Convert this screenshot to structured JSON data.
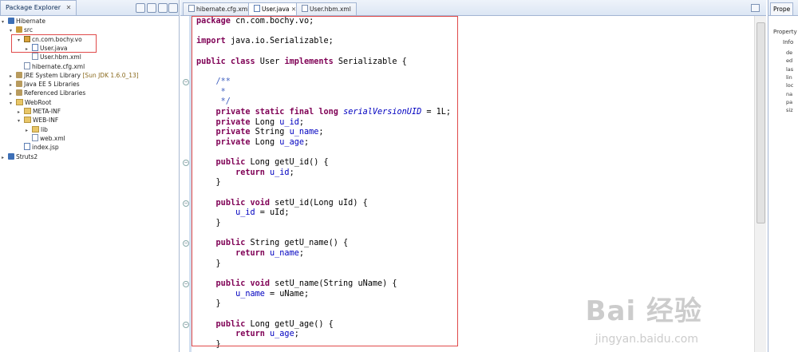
{
  "package_explorer": {
    "title": "Package Explorer",
    "tree": [
      {
        "indent": 0,
        "twisty": "▾",
        "icon": "project",
        "label": "Hibernate"
      },
      {
        "indent": 1,
        "twisty": "▾",
        "icon": "src",
        "label": "src"
      },
      {
        "indent": 2,
        "twisty": "▾",
        "icon": "package",
        "label": "cn.com.bochy.vo"
      },
      {
        "indent": 3,
        "twisty": "▸",
        "icon": "java",
        "label": "User.java"
      },
      {
        "indent": 3,
        "twisty": "",
        "icon": "xml",
        "label": "User.hbm.xml"
      },
      {
        "indent": 2,
        "twisty": "",
        "icon": "xml",
        "label": "hibernate.cfg.xml"
      },
      {
        "indent": 1,
        "twisty": "▸",
        "icon": "lib",
        "label": "JRE System Library",
        "suffix": "[Sun JDK 1.6.0_13]"
      },
      {
        "indent": 1,
        "twisty": "▸",
        "icon": "lib",
        "label": "Java EE 5 Libraries"
      },
      {
        "indent": 1,
        "twisty": "▸",
        "icon": "lib",
        "label": "Referenced Libraries"
      },
      {
        "indent": 1,
        "twisty": "▾",
        "icon": "folder",
        "label": "WebRoot"
      },
      {
        "indent": 2,
        "twisty": "▸",
        "icon": "folder",
        "label": "META-INF"
      },
      {
        "indent": 2,
        "twisty": "▾",
        "icon": "folder",
        "label": "WEB-INF"
      },
      {
        "indent": 3,
        "twisty": "▸",
        "icon": "folder",
        "label": "lib"
      },
      {
        "indent": 3,
        "twisty": "",
        "icon": "xml",
        "label": "web.xml"
      },
      {
        "indent": 2,
        "twisty": "",
        "icon": "java",
        "label": "index.jsp"
      },
      {
        "indent": 0,
        "twisty": "▸",
        "icon": "project",
        "label": "Struts2"
      }
    ]
  },
  "editor": {
    "tabs": [
      {
        "label": "hibernate.cfg.xml",
        "active": false
      },
      {
        "label": "User.java",
        "active": true
      },
      {
        "label": "User.hbm.xml",
        "active": false
      }
    ],
    "lines": [
      [
        {
          "t": "package",
          "c": "kw"
        },
        {
          "t": " cn.com.bochy.vo;"
        }
      ],
      [],
      [
        {
          "t": "import",
          "c": "kw"
        },
        {
          "t": " java.io.Serializable;"
        }
      ],
      [],
      [
        {
          "t": "public",
          "c": "kw"
        },
        {
          "t": " "
        },
        {
          "t": "class",
          "c": "kw"
        },
        {
          "t": " User "
        },
        {
          "t": "implements",
          "c": "kw"
        },
        {
          "t": " Serializable {"
        }
      ],
      [],
      [
        {
          "t": "    /**",
          "c": "cm"
        }
      ],
      [
        {
          "t": "     *",
          "c": "cm"
        }
      ],
      [
        {
          "t": "     */",
          "c": "cm"
        }
      ],
      [
        {
          "t": "    "
        },
        {
          "t": "private",
          "c": "kw"
        },
        {
          "t": " "
        },
        {
          "t": "static",
          "c": "kw"
        },
        {
          "t": " "
        },
        {
          "t": "final",
          "c": "kw"
        },
        {
          "t": " "
        },
        {
          "t": "long",
          "c": "kw"
        },
        {
          "t": " "
        },
        {
          "t": "serialVersionUID",
          "c": "st"
        },
        {
          "t": " = 1L;"
        }
      ],
      [
        {
          "t": "    "
        },
        {
          "t": "private",
          "c": "kw"
        },
        {
          "t": " Long "
        },
        {
          "t": "u_id",
          "c": "fld"
        },
        {
          "t": ";"
        }
      ],
      [
        {
          "t": "    "
        },
        {
          "t": "private",
          "c": "kw"
        },
        {
          "t": " String "
        },
        {
          "t": "u_name",
          "c": "fld"
        },
        {
          "t": ";"
        }
      ],
      [
        {
          "t": "    "
        },
        {
          "t": "private",
          "c": "kw"
        },
        {
          "t": " Long "
        },
        {
          "t": "u_age",
          "c": "fld"
        },
        {
          "t": ";"
        }
      ],
      [],
      [
        {
          "t": "    "
        },
        {
          "t": "public",
          "c": "kw"
        },
        {
          "t": " Long getU_id() {"
        }
      ],
      [
        {
          "t": "        "
        },
        {
          "t": "return",
          "c": "kw"
        },
        {
          "t": " "
        },
        {
          "t": "u_id",
          "c": "fld"
        },
        {
          "t": ";"
        }
      ],
      [
        {
          "t": "    }"
        }
      ],
      [],
      [
        {
          "t": "    "
        },
        {
          "t": "public",
          "c": "kw"
        },
        {
          "t": " "
        },
        {
          "t": "void",
          "c": "kw"
        },
        {
          "t": " setU_id(Long uId) {"
        }
      ],
      [
        {
          "t": "        "
        },
        {
          "t": "u_id",
          "c": "fld"
        },
        {
          "t": " = uId;"
        }
      ],
      [
        {
          "t": "    }"
        }
      ],
      [],
      [
        {
          "t": "    "
        },
        {
          "t": "public",
          "c": "kw"
        },
        {
          "t": " String getU_name() {"
        }
      ],
      [
        {
          "t": "        "
        },
        {
          "t": "return",
          "c": "kw"
        },
        {
          "t": " "
        },
        {
          "t": "u_name",
          "c": "fld"
        },
        {
          "t": ";"
        }
      ],
      [
        {
          "t": "    }"
        }
      ],
      [],
      [
        {
          "t": "    "
        },
        {
          "t": "public",
          "c": "kw"
        },
        {
          "t": " "
        },
        {
          "t": "void",
          "c": "kw"
        },
        {
          "t": " setU_name(String uName) {"
        }
      ],
      [
        {
          "t": "        "
        },
        {
          "t": "u_name",
          "c": "fld"
        },
        {
          "t": " = uName;"
        }
      ],
      [
        {
          "t": "    }"
        }
      ],
      [],
      [
        {
          "t": "    "
        },
        {
          "t": "public",
          "c": "kw"
        },
        {
          "t": " Long getU_age() {"
        }
      ],
      [
        {
          "t": "        "
        },
        {
          "t": "return",
          "c": "kw"
        },
        {
          "t": " "
        },
        {
          "t": "u_age",
          "c": "fld"
        },
        {
          "t": ";"
        }
      ],
      [
        {
          "t": "    }"
        }
      ]
    ]
  },
  "properties": {
    "title": "Prope",
    "header": "Property",
    "group": "Info",
    "rows": [
      "de",
      "ed",
      "las",
      "lin",
      "loc",
      "na",
      "pa",
      "siz"
    ]
  },
  "watermark": {
    "main": "Bai 经验",
    "url": "jingyan.baidu.com"
  }
}
